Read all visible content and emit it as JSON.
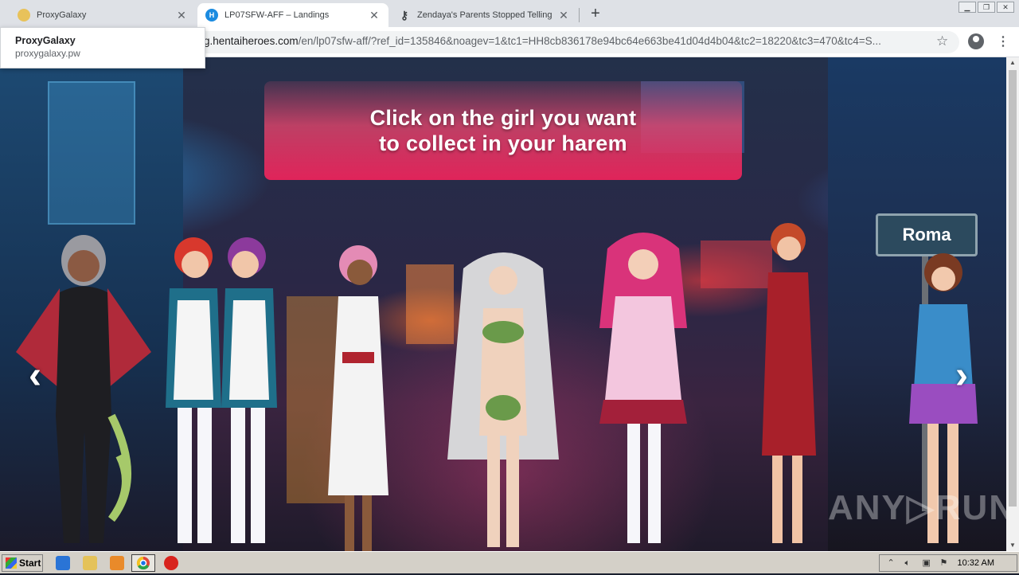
{
  "tabs": [
    {
      "title": "ProxyGalaxy",
      "favicon_color": "#e8c25a",
      "favicon": "galaxy-icon"
    },
    {
      "title": "LP07SFW-AFF – Landings",
      "favicon_color": "#1b8be0",
      "favicon": "hh-icon",
      "favicon_text": "H",
      "active": true
    },
    {
      "title": "Zendaya's Parents Stopped Telling H",
      "favicon": "key-icon"
    }
  ],
  "tooltip": {
    "title": "ProxyGalaxy",
    "url": "proxygalaxy.pw"
  },
  "address": {
    "host": "g.hentaiheroes.com",
    "path": "/en/lp07sfw-aff/?ref_id=135846&noagev=1&tc1=HH8cb836178e94bc64e663be41d04d4b04&tc2=18220&tc3=470&tc4=S..."
  },
  "banner": {
    "line1": "Click on the girl you want",
    "line2": "to collect in your harem"
  },
  "sign": "Roma",
  "nav": {
    "prev": "‹",
    "next": "›"
  },
  "watermark": "ANY▷RUN",
  "taskbar": {
    "start": "Start",
    "clock": "10:32 AM"
  },
  "colors": {
    "banner": "#e0245a",
    "accent_blue": "#1b8be0"
  }
}
